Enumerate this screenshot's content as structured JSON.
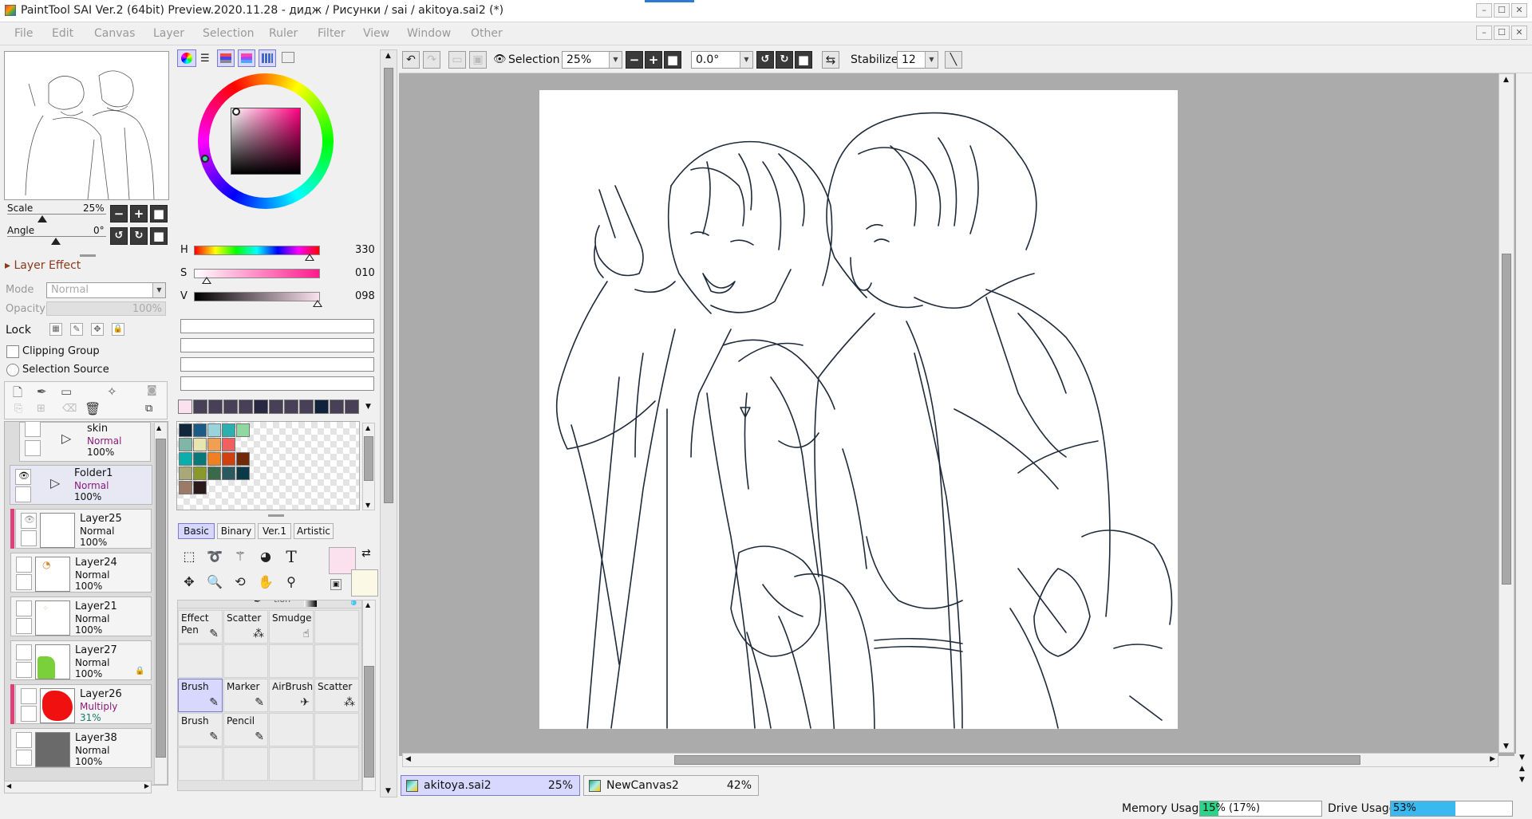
{
  "window": {
    "title": "PaintTool SAI Ver.2 (64bit) Preview.2020.11.28 - дидж / Рисунки / sai / akitoya.sai2 (*)",
    "controls": [
      "–",
      "☐",
      "✕"
    ]
  },
  "menu": [
    "File",
    "Edit",
    "Canvas",
    "Layer",
    "Selection",
    "Ruler",
    "Filter",
    "View",
    "Window",
    "Other"
  ],
  "navigator": {
    "scale_label": "Scale",
    "scale_value": "25%",
    "angle_label": "Angle",
    "angle_value": "0°"
  },
  "layer_effect": {
    "header": "Layer Effect",
    "mode_label": "Mode",
    "mode_value": "Normal",
    "opacity_label": "Opacity",
    "opacity_value": "100%",
    "lock_label": "Lock",
    "clipping_group": "Clipping Group",
    "selection_source": "Selection Source"
  },
  "layers": [
    {
      "name": "skin",
      "mode": "Normal",
      "opacity": "100%",
      "type": "folder"
    },
    {
      "name": "Folder1",
      "mode": "Normal",
      "opacity": "100%",
      "type": "folder"
    },
    {
      "name": "Layer25",
      "mode": "Normal",
      "opacity": "100%",
      "type": "layer"
    },
    {
      "name": "Layer24",
      "mode": "Normal",
      "opacity": "100%",
      "type": "layer"
    },
    {
      "name": "Layer21",
      "mode": "Normal",
      "opacity": "100%",
      "type": "layer"
    },
    {
      "name": "Layer27",
      "mode": "Normal",
      "opacity": "100%",
      "type": "layer"
    },
    {
      "name": "Layer26",
      "mode": "Multiply",
      "opacity": "31%",
      "type": "layer"
    },
    {
      "name": "Layer38",
      "mode": "Normal",
      "opacity": "100%",
      "type": "layer"
    }
  ],
  "color": {
    "h_label": "H",
    "h_value": "330",
    "h_level": 0.917,
    "s_label": "S",
    "s_value": "010",
    "s_level": 0.1,
    "v_label": "V",
    "v_value": "098",
    "v_level": 0.98,
    "current": "#fbe1ee",
    "secondary": "#fbf8e6",
    "recent": [
      "#fbe1ee",
      "#474057",
      "#474057",
      "#474057",
      "#474057",
      "#292742",
      "#474057",
      "#474057",
      "#474057",
      "#10233a",
      "#474057",
      "#474057"
    ],
    "swatches": [
      [
        "#10263a",
        "#1a5c86",
        "#97d4dc",
        "#2bb0b0",
        "#8fd8a0"
      ],
      [
        "#7fb6a8",
        "#e8e6b0",
        "#f0a050",
        "#f06060"
      ],
      [
        "#0aaeaa",
        "#087878",
        "#f08020",
        "#d04010",
        "#702a0a"
      ],
      [
        "#a8a878",
        "#8a9a2a",
        "#3a6a4a",
        "#2a5a60",
        "#0a3a48"
      ],
      [
        "#9c7a68",
        "#2a1a1a"
      ]
    ]
  },
  "tools": {
    "tabs": [
      "Basic",
      "Binary",
      "Ver.1",
      "Artistic"
    ],
    "active_tab": "Basic",
    "brushes": [
      {
        "label": "Effect\nPen",
        "icon": "✎"
      },
      {
        "label": "Scatter",
        "icon": "⁂"
      },
      {
        "label": "Smudge",
        "icon": "☝"
      },
      {
        "label": "Brush",
        "icon": "✎",
        "selected": true
      },
      {
        "label": "Marker",
        "icon": "✎"
      },
      {
        "label": "AirBrush",
        "icon": "✈"
      },
      {
        "label": "Scatter",
        "icon": "⁂"
      },
      {
        "label": "Brush",
        "icon": "✎"
      },
      {
        "label": "Pencil",
        "icon": "✎"
      }
    ]
  },
  "toolbar": {
    "selection_label": "Selection",
    "zoom_value": "25%",
    "rotation_value": "0.0°",
    "stabilizer_label": "Stabilizer",
    "stabilizer_value": "12"
  },
  "documents": [
    {
      "name": "akitoya.sai2",
      "zoom": "25%",
      "active": true
    },
    {
      "name": "NewCanvas2",
      "zoom": "42%",
      "active": false
    }
  ],
  "status": {
    "memory_label": "Memory Usage",
    "memory_value": "15% (17%)",
    "memory_level": 0.15,
    "drive_label": "Drive Usage",
    "drive_value": "53%",
    "drive_level": 0.53
  }
}
